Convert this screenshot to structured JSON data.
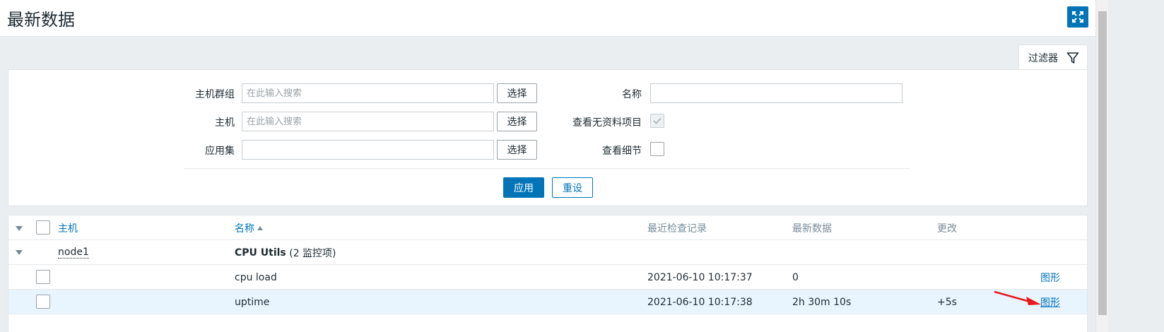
{
  "page": {
    "title": "最新数据"
  },
  "icons": {
    "fullscreen": "fullscreen-expand-icon",
    "filter": "funnel-filter-icon",
    "checkmark": "check-icon",
    "annotation_arrow": "red-arrow-annotation"
  },
  "colors": {
    "accent": "#0275b8",
    "row_highlight": "#e8f5ff",
    "header_text": "#768d99",
    "annotation": "#e8191c"
  },
  "filter": {
    "tab_label": "过滤器",
    "host_group_label": "主机群组",
    "host_group_placeholder": "在此输入搜索",
    "host_label": "主机",
    "host_placeholder": "在此输入搜索",
    "application_label": "应用集",
    "application_value": "",
    "select_label": "选择",
    "name_label": "名称",
    "name_value": "",
    "show_no_data_label": "查看无资料项目",
    "show_no_data_checked": true,
    "show_details_label": "查看细节",
    "show_details_checked": false,
    "apply_label": "应用",
    "reset_label": "重设"
  },
  "table": {
    "columns": {
      "host": "主机",
      "name": "名称",
      "last_check": "最近检查记录",
      "last_value": "最新数据",
      "change": "更改"
    },
    "group": {
      "host": "node1",
      "application": "CPU Utils",
      "count_text": "(2 监控项)"
    },
    "rows": [
      {
        "name": "cpu load",
        "last_check": "2021-06-10 10:17:37",
        "last_value": "0",
        "change": "",
        "action": "图形"
      },
      {
        "name": "uptime",
        "last_check": "2021-06-10 10:17:38",
        "last_value": "2h 30m 10s",
        "change": "+5s",
        "action": "图形"
      }
    ]
  }
}
